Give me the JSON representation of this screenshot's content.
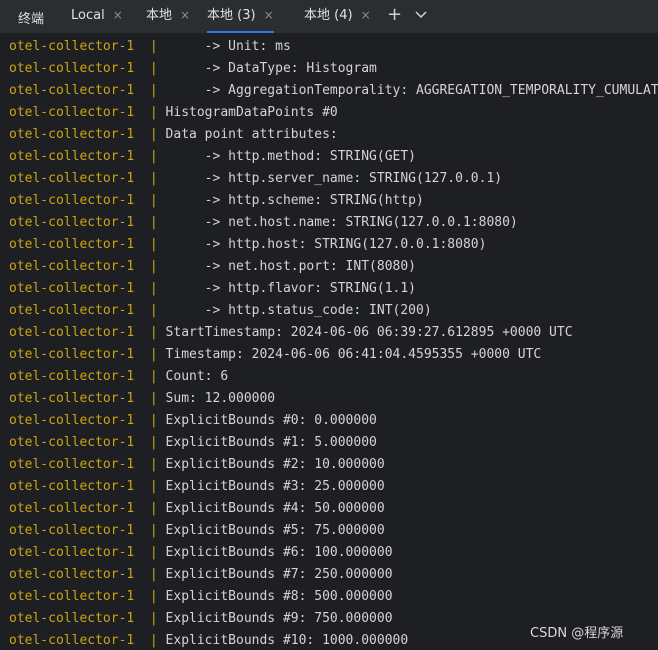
{
  "tool_window": {
    "title": "终端"
  },
  "tabs": [
    {
      "label": "Local",
      "active": false
    },
    {
      "label": "本地",
      "active": false
    },
    {
      "label": "本地 (3)",
      "active": true
    },
    {
      "label": "本地 (4)",
      "active": false
    }
  ],
  "tab_close_glyph": "×",
  "tab_add_glyph": "+",
  "colors": {
    "service_prefix": "#c8a614",
    "message_text": "#d4d4d4",
    "active_tab_underline": "#3574f0",
    "background": "#1e1f22"
  },
  "terminal": {
    "separator": "|",
    "lines": [
      {
        "service": "otel-collector-1",
        "text": "     -> Unit: ms"
      },
      {
        "service": "otel-collector-1",
        "text": "     -> DataType: Histogram"
      },
      {
        "service": "otel-collector-1",
        "text": "     -> AggregationTemporality: AGGREGATION_TEMPORALITY_CUMULATIVE"
      },
      {
        "service": "otel-collector-1",
        "text": "HistogramDataPoints #0"
      },
      {
        "service": "otel-collector-1",
        "text": "Data point attributes:"
      },
      {
        "service": "otel-collector-1",
        "text": "     -> http.method: STRING(GET)"
      },
      {
        "service": "otel-collector-1",
        "text": "     -> http.server_name: STRING(127.0.0.1)"
      },
      {
        "service": "otel-collector-1",
        "text": "     -> http.scheme: STRING(http)"
      },
      {
        "service": "otel-collector-1",
        "text": "     -> net.host.name: STRING(127.0.0.1:8080)"
      },
      {
        "service": "otel-collector-1",
        "text": "     -> http.host: STRING(127.0.0.1:8080)"
      },
      {
        "service": "otel-collector-1",
        "text": "     -> net.host.port: INT(8080)"
      },
      {
        "service": "otel-collector-1",
        "text": "     -> http.flavor: STRING(1.1)"
      },
      {
        "service": "otel-collector-1",
        "text": "     -> http.status_code: INT(200)"
      },
      {
        "service": "otel-collector-1",
        "text": "StartTimestamp: 2024-06-06 06:39:27.612895 +0000 UTC"
      },
      {
        "service": "otel-collector-1",
        "text": "Timestamp: 2024-06-06 06:41:04.4595355 +0000 UTC"
      },
      {
        "service": "otel-collector-1",
        "text": "Count: 6"
      },
      {
        "service": "otel-collector-1",
        "text": "Sum: 12.000000"
      },
      {
        "service": "otel-collector-1",
        "text": "ExplicitBounds #0: 0.000000"
      },
      {
        "service": "otel-collector-1",
        "text": "ExplicitBounds #1: 5.000000"
      },
      {
        "service": "otel-collector-1",
        "text": "ExplicitBounds #2: 10.000000"
      },
      {
        "service": "otel-collector-1",
        "text": "ExplicitBounds #3: 25.000000"
      },
      {
        "service": "otel-collector-1",
        "text": "ExplicitBounds #4: 50.000000"
      },
      {
        "service": "otel-collector-1",
        "text": "ExplicitBounds #5: 75.000000"
      },
      {
        "service": "otel-collector-1",
        "text": "ExplicitBounds #6: 100.000000"
      },
      {
        "service": "otel-collector-1",
        "text": "ExplicitBounds #7: 250.000000"
      },
      {
        "service": "otel-collector-1",
        "text": "ExplicitBounds #8: 500.000000"
      },
      {
        "service": "otel-collector-1",
        "text": "ExplicitBounds #9: 750.000000"
      },
      {
        "service": "otel-collector-1",
        "text": "ExplicitBounds #10: 1000.000000"
      }
    ]
  },
  "watermark": "CSDN @程序源"
}
